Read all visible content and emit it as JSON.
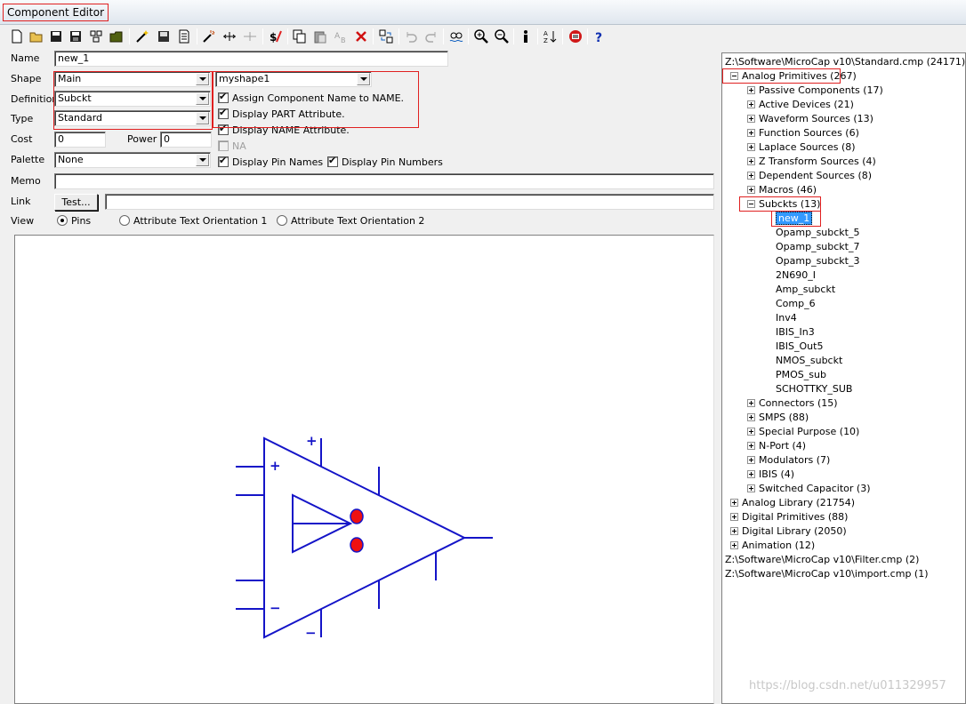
{
  "window": {
    "title": "Component Editor"
  },
  "toolbar": {
    "icons": [
      "new-icon",
      "open-icon",
      "save-icon",
      "save-as-icon",
      "library-icon",
      "folder-icon",
      "wand-icon",
      "disk-icon",
      "document-icon",
      "magic-wand-icon",
      "pin-add-icon",
      "pin-remove-icon",
      "dollar-icon",
      "copy-icon",
      "paste-icon",
      "replace-icon",
      "delete-icon",
      "merge-icon",
      "undo-icon",
      "redo-icon",
      "find-icon",
      "zoom-in-icon",
      "zoom-out-icon",
      "info-icon",
      "sort-icon",
      "stop-icon",
      "help-icon"
    ]
  },
  "form": {
    "name_label": "Name",
    "name_value": "new_1",
    "shape_label": "Shape",
    "shape_value": "Main",
    "shape2_value": "myshape1",
    "definition_label": "Definition",
    "definition_value": "Subckt",
    "type_label": "Type",
    "type_value": "Standard",
    "cost_label": "Cost",
    "cost_value": "0",
    "power_label": "Power",
    "power_value": "0",
    "palette_label": "Palette",
    "palette_value": "None",
    "memo_label": "Memo",
    "memo_value": "",
    "link_label": "Link",
    "test_button": "Test...",
    "link_value": "",
    "view_label": "View",
    "view_options": [
      "Pins",
      "Attribute Text Orientation 1",
      "Attribute Text Orientation 2"
    ],
    "checkboxes": {
      "assign_name": "Assign Component Name to NAME.",
      "display_part": "Display PART Attribute.",
      "display_name": "Display NAME Attribute.",
      "na": "NA",
      "display_pin_names": "Display Pin Names",
      "display_pin_numbers": "Display Pin Numbers"
    }
  },
  "canvas": {
    "plus_top": "+",
    "plus_left": "+",
    "minus_left": "−",
    "minus_bottom": "−"
  },
  "tree": {
    "root1": "Z:\\Software\\MicroCap v10\\Standard.cmp (24171)",
    "analog_primitives": "Analog Primitives (267)",
    "children": [
      "Passive Components (17)",
      "Active Devices (21)",
      "Waveform Sources (13)",
      "Function Sources (6)",
      "Laplace Sources (8)",
      "Z Transform Sources (4)",
      "Dependent Sources (8)",
      "Macros (46)"
    ],
    "subckts": "Subckts (13)",
    "subckt_items": [
      "new_1",
      "Opamp_subckt_5",
      "Opamp_subckt_7",
      "Opamp_subckt_3",
      "2N690_I",
      "Amp_subckt",
      "Comp_6",
      "Inv4",
      "IBIS_In3",
      "IBIS_Out5",
      "NMOS_subckt",
      "PMOS_sub",
      "SCHOTTKY_SUB"
    ],
    "after_subckts": [
      "Connectors (15)",
      "SMPS (88)",
      "Special Purpose (10)",
      "N-Port (4)",
      "Modulators (7)",
      "IBIS (4)",
      "Switched Capacitor (3)"
    ],
    "top_level": [
      "Analog Library (21754)",
      "Digital Primitives (88)",
      "Digital Library (2050)",
      "Animation (12)"
    ],
    "root2": "Z:\\Software\\MicroCap v10\\Filter.cmp (2)",
    "root3": "Z:\\Software\\MicroCap v10\\import.cmp (1)"
  },
  "watermark": "https://blog.csdn.net/u011329957",
  "colors": {
    "symbol": "#1414c8",
    "pin_dot": "#ee1111",
    "highlight": "#e02020",
    "selection": "#3399ff"
  }
}
